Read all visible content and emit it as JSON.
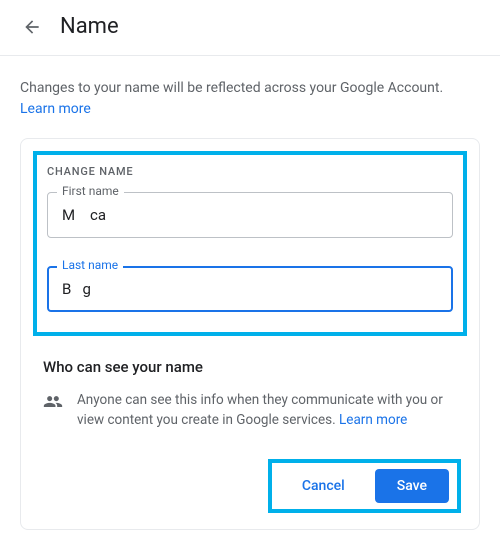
{
  "header": {
    "title": "Name"
  },
  "description": {
    "text": "Changes to your name will be reflected across your Google Account. ",
    "learn_more": "Learn more"
  },
  "form": {
    "section_label": "CHANGE NAME",
    "first_name": {
      "label": "First name",
      "value": "M    ca"
    },
    "last_name": {
      "label": "Last name",
      "value": "B   g"
    }
  },
  "visibility": {
    "title": "Who can see your name",
    "text": "Anyone can see this info when they communicate with you or view content you create in Google services. ",
    "learn_more": "Learn more"
  },
  "actions": {
    "cancel": "Cancel",
    "save": "Save"
  }
}
